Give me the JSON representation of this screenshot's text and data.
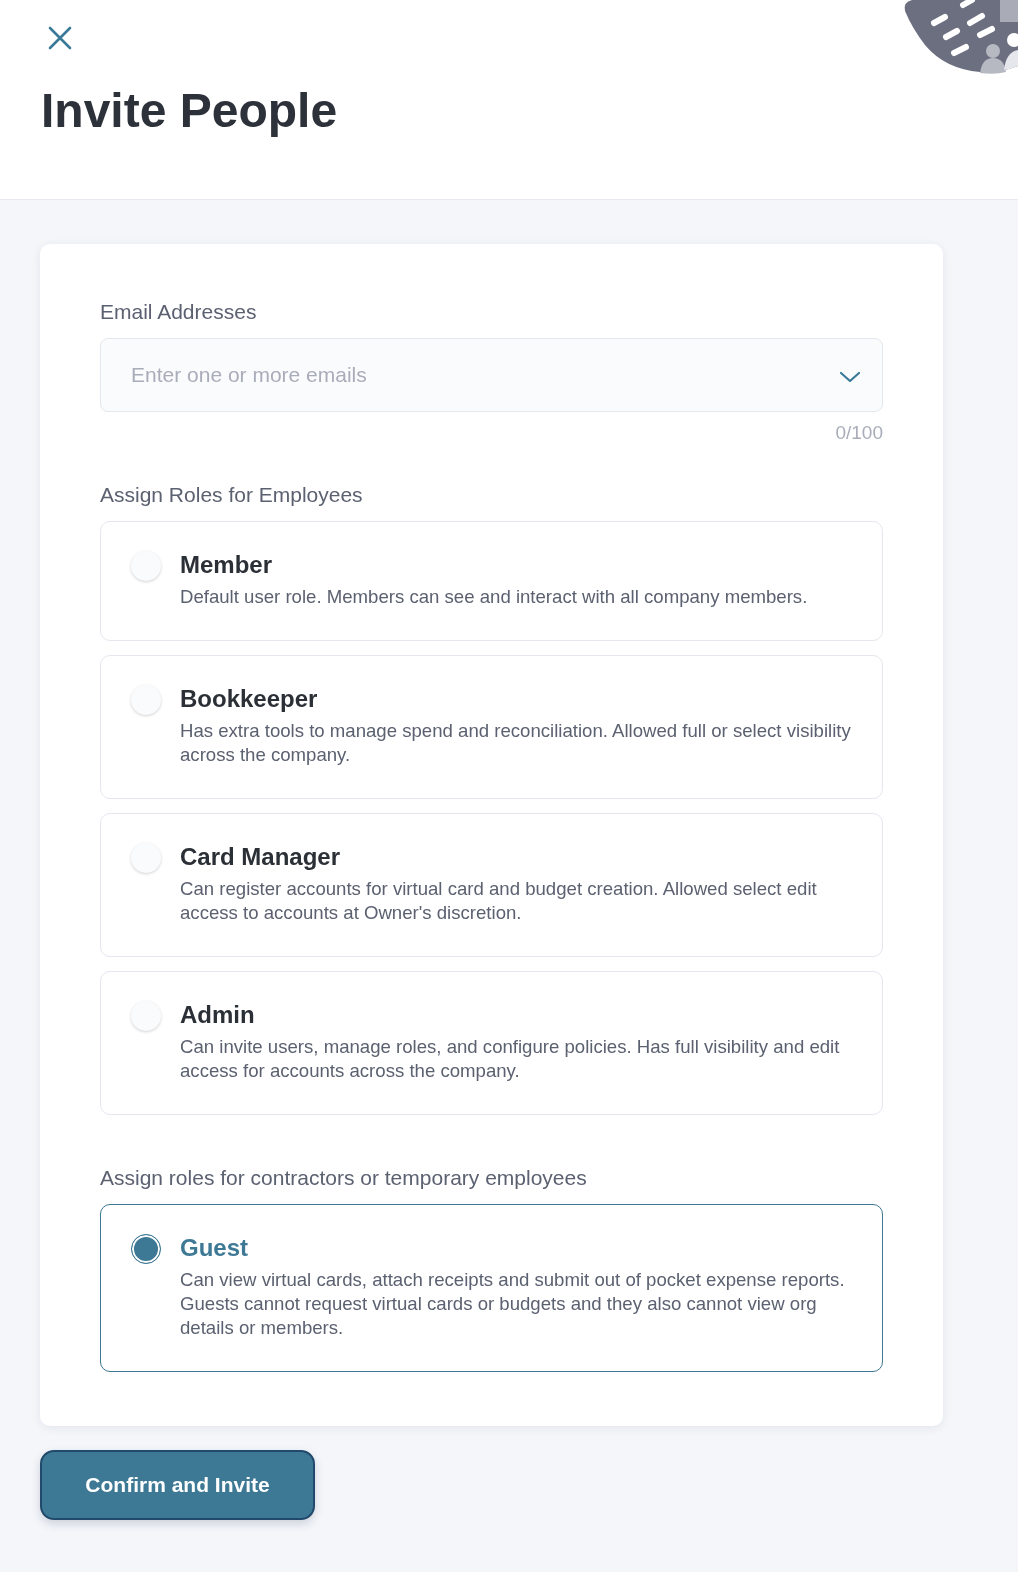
{
  "header": {
    "title": "Invite People"
  },
  "email": {
    "label": "Email Addresses",
    "placeholder": "Enter one or more emails",
    "counter": "0/100"
  },
  "role_groups": [
    {
      "heading": "Assign Roles for Employees",
      "roles": [
        {
          "name": "Member",
          "description": "Default user role. Members can see and interact with all company members.",
          "selected": false
        },
        {
          "name": "Bookkeeper",
          "description": "Has extra tools to manage spend and reconciliation. Allowed full or select visibility across the company.",
          "selected": false
        },
        {
          "name": "Card Manager",
          "description": "Can register accounts for virtual card and budget creation. Allowed select edit access to accounts at Owner's discretion.",
          "selected": false
        },
        {
          "name": "Admin",
          "description": "Can invite users, manage roles, and configure policies. Has full visibility and edit access for accounts across the company.",
          "selected": false
        }
      ]
    },
    {
      "heading": "Assign roles for contractors or temporary employees",
      "roles": [
        {
          "name": "Guest",
          "description": "Can view virtual cards, attach receipts and submit out of pocket expense reports. Guests cannot request virtual cards or budgets and they also cannot view org details or members.",
          "selected": true
        }
      ]
    }
  ],
  "confirm_button": {
    "label": "Confirm and Invite"
  }
}
